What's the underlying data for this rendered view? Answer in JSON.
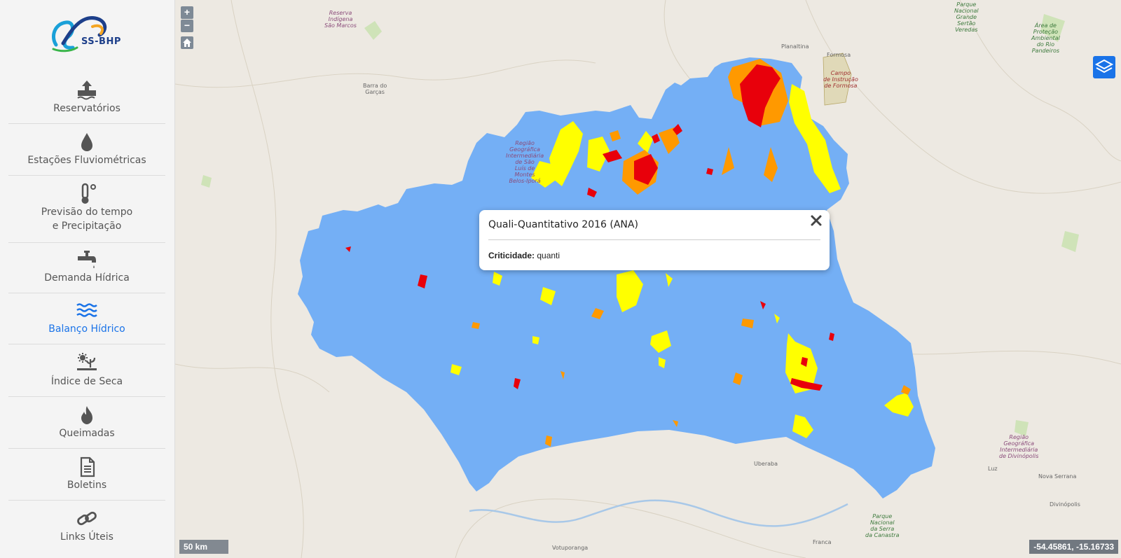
{
  "app": {
    "logo_text": "SS-BHP"
  },
  "sidebar": {
    "items": [
      {
        "label": "Reservatórios",
        "icon": "reservoir-icon",
        "active": false
      },
      {
        "label": "Estações Fluviométricas",
        "icon": "water-drop-icon",
        "active": false
      },
      {
        "label": "Previsão do tempo\ne Precipitação",
        "icon": "thermometer-icon",
        "active": false
      },
      {
        "label": "Demanda Hídrica",
        "icon": "faucet-icon",
        "active": false
      },
      {
        "label": "Balanço Hídrico",
        "icon": "water-waves-icon",
        "active": true
      },
      {
        "label": "Índice de Seca",
        "icon": "drought-sun-icon",
        "active": false
      },
      {
        "label": "Queimadas",
        "icon": "fire-icon",
        "active": false
      },
      {
        "label": "Boletins",
        "icon": "document-icon",
        "active": false
      },
      {
        "label": "Links Úteis",
        "icon": "link-icon",
        "active": false
      }
    ]
  },
  "map": {
    "zoom_in": "+",
    "zoom_out": "−",
    "scale_label": "50 km",
    "coordinates": "-54.45861, -15.16733",
    "colors": {
      "basin": "#74aff5",
      "critical_quanti": "#e8000b",
      "critical_medium": "#ff9900",
      "critical_low": "#ffff00",
      "background": "#ede9e2"
    },
    "places": [
      {
        "name": "Reserva\nIndígena\nSão Marcos",
        "style": "purple"
      },
      {
        "name": "Barra do\nGarças",
        "style": ""
      },
      {
        "name": "Região\nGeográfica\nIntermediária\nde São\nLuís de\nMontes\nBelos-Iporá",
        "style": "purple"
      },
      {
        "name": "Planaltina",
        "style": ""
      },
      {
        "name": "Formosa",
        "style": ""
      },
      {
        "name": "Campo\nde Instrução\nde Formosa",
        "style": "red"
      },
      {
        "name": "Parque\nNacional\nGrande\nSertão\nVeredas",
        "style": "green"
      },
      {
        "name": "Área de\nProteção\nAmbiental\ndo Rio\nPandeiros",
        "style": "green"
      },
      {
        "name": "Uberaba",
        "style": ""
      },
      {
        "name": "Votuporanga",
        "style": ""
      },
      {
        "name": "Franca",
        "style": ""
      },
      {
        "name": "Luz",
        "style": ""
      },
      {
        "name": "Nova Serrana",
        "style": ""
      },
      {
        "name": "Divinópolis",
        "style": ""
      },
      {
        "name": "Região\nGeográfica\nIntermediária\nde Divinópolis",
        "style": "purple"
      },
      {
        "name": "Parque\nNacional\nda Serra\nda Canastra",
        "style": "green"
      }
    ]
  },
  "popup": {
    "title": "Quali-Quantitativo 2016 (ANA)",
    "field_label": "Criticidade:",
    "field_value": "quanti"
  }
}
